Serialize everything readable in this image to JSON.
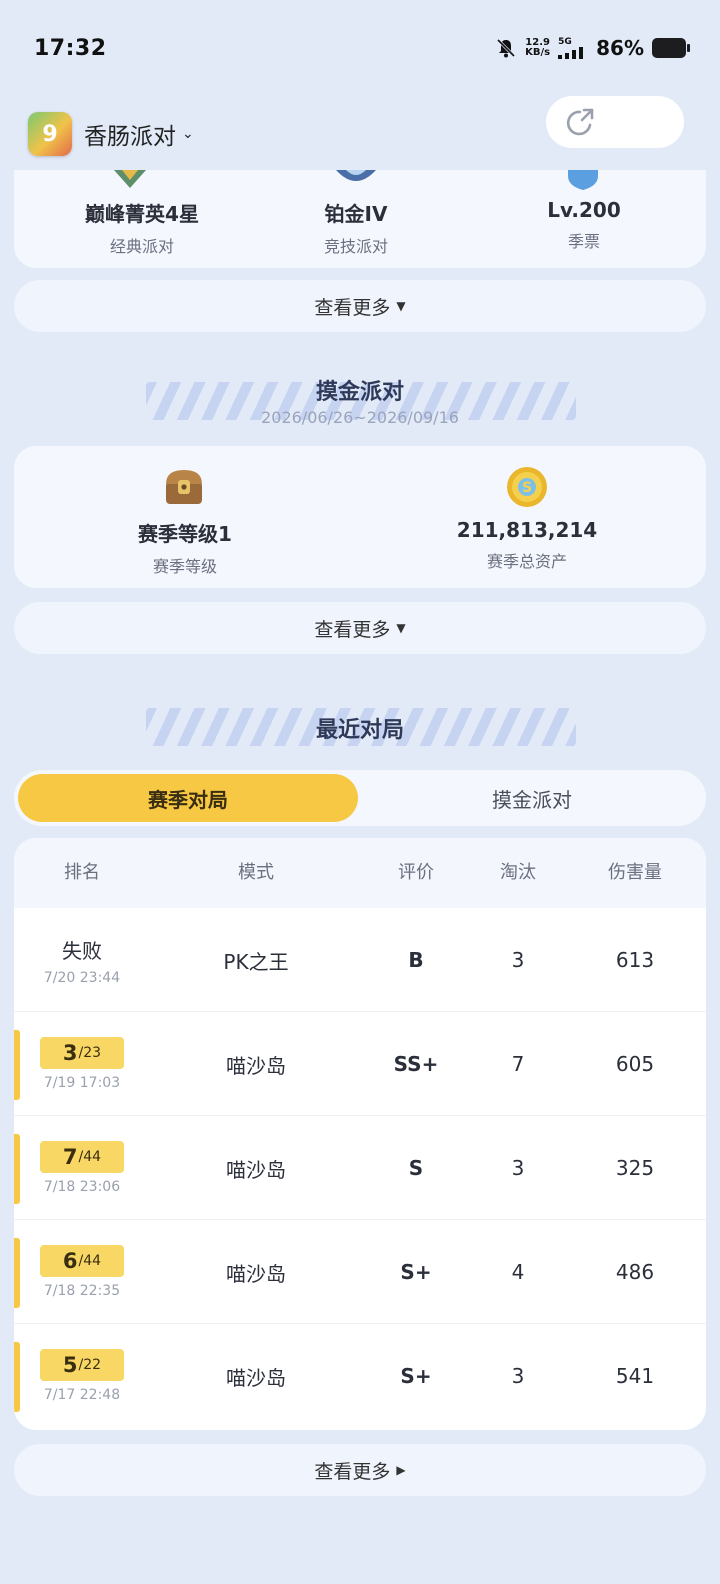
{
  "status": {
    "time": "17:32",
    "net_speed_value": "12.9",
    "net_speed_unit": "KB/s",
    "signal": "5G",
    "battery": "86%"
  },
  "header": {
    "game_name": "香肠派对",
    "share_icon": "share-arrow-icon"
  },
  "ranks": [
    {
      "value": "巅峰菁英4星",
      "label": "经典派对"
    },
    {
      "value": "铂金IV",
      "label": "竞技派对"
    },
    {
      "value": "Lv.200",
      "label": "季票"
    }
  ],
  "more_label": "查看更多",
  "gold_party": {
    "title": "摸金派对",
    "dates": "2026/06/26~2026/09/16",
    "stats": [
      {
        "value": "赛季等级1",
        "label": "赛季等级",
        "icon": "chest-icon"
      },
      {
        "value": "211,813,214",
        "label": "赛季总资产",
        "icon": "coin-icon"
      }
    ]
  },
  "recent": {
    "title": "最近对局",
    "tabs": [
      "赛季对局",
      "摸金派对"
    ],
    "columns": [
      "排名",
      "模式",
      "评价",
      "淘汰",
      "伤害量"
    ],
    "rows": [
      {
        "result": "失败",
        "time": "7/20 23:44",
        "mode": "PK之王",
        "grade": "B",
        "kills": "3",
        "damage": "613"
      },
      {
        "rank": "3",
        "total": "/23",
        "time": "7/19 17:03",
        "mode": "喵沙岛",
        "grade": "SS+",
        "kills": "7",
        "damage": "605"
      },
      {
        "rank": "7",
        "total": "/44",
        "time": "7/18 23:06",
        "mode": "喵沙岛",
        "grade": "S",
        "kills": "3",
        "damage": "325"
      },
      {
        "rank": "6",
        "total": "/44",
        "time": "7/18 22:35",
        "mode": "喵沙岛",
        "grade": "S+",
        "kills": "4",
        "damage": "486"
      },
      {
        "rank": "5",
        "total": "/22",
        "time": "7/17 22:48",
        "mode": "喵沙岛",
        "grade": "S+",
        "kills": "3",
        "damage": "541"
      }
    ]
  },
  "colors": {
    "accent": "#f7c843",
    "background": "#e2eaf8",
    "card": "#f4f7fd"
  }
}
